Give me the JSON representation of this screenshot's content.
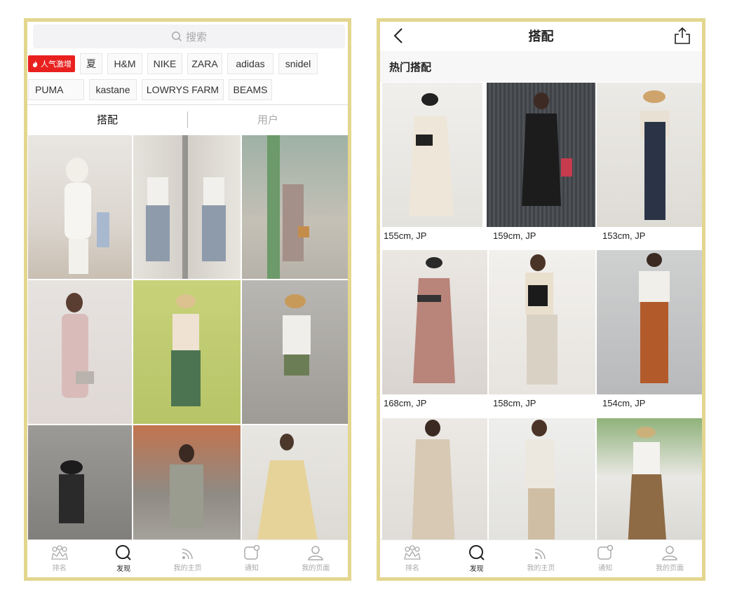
{
  "left_screen": {
    "search": {
      "placeholder": "搜索"
    },
    "hot_tag": "人气激增",
    "tags_row1": [
      "夏",
      "H&M",
      "NIKE",
      "ZARA",
      "adidas",
      "snidel"
    ],
    "tags_row2": [
      "PUMA",
      "kastane",
      "LOWRYS FARM",
      "BEAMS"
    ],
    "tabs": [
      "搭配",
      "用户"
    ],
    "active_tab": "搭配"
  },
  "right_screen": {
    "title": "搭配",
    "section_title": "热门搭配",
    "captions": [
      "155cm, JP",
      "159cm, JP",
      "153cm, JP",
      "168cm, JP",
      "158cm, JP",
      "154cm, JP"
    ]
  },
  "tabbar": {
    "items": [
      "排名",
      "发现",
      "我的主页",
      "通知",
      "我的页面"
    ],
    "active": "发现"
  },
  "colors": {
    "frame": "#e3d68e",
    "hot_tag": "#e8211f",
    "search_bg": "#f3f3f5"
  }
}
